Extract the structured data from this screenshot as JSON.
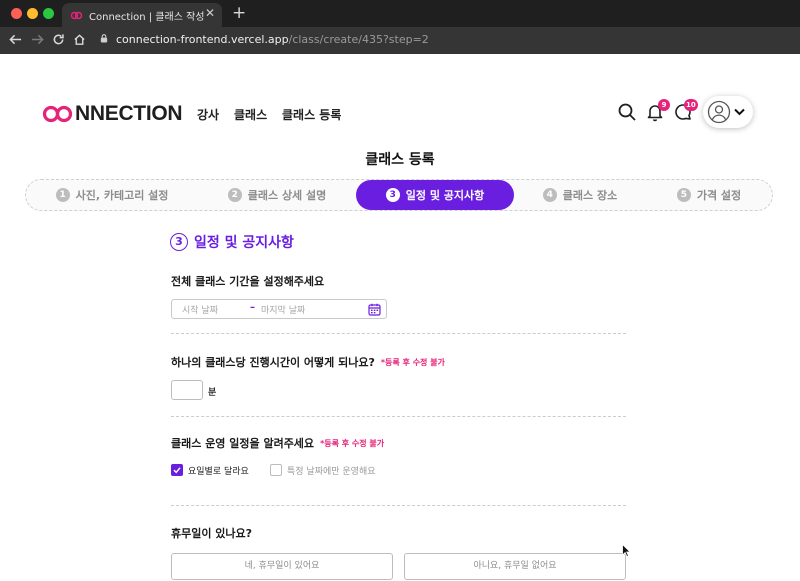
{
  "browser": {
    "tab_title": "Connection | 클래스 작성",
    "tab_close": "✕",
    "new_tab": "+",
    "url_host": "connection-frontend.vercel.app",
    "url_path": "/class/create/435?step=2"
  },
  "header": {
    "logo_text": "NNECTION",
    "nav": [
      "강사",
      "클래스",
      "클래스 등록"
    ],
    "notification_count": "9",
    "message_count": "10"
  },
  "page_title": "클래스 등록",
  "steps": [
    {
      "num": "1",
      "label": "사진, 카테고리 설정"
    },
    {
      "num": "2",
      "label": "클래스 상세 설명"
    },
    {
      "num": "3",
      "label": "일정 및 공지사항"
    },
    {
      "num": "4",
      "label": "클래스 장소"
    },
    {
      "num": "5",
      "label": "가격 설정"
    }
  ],
  "active_step": 3,
  "section": {
    "num": "3",
    "title": "일정 및 공지사항"
  },
  "period": {
    "question": "전체 클래스 기간을 설정해주세요",
    "start_placeholder": "시작 날짜",
    "separator": "–",
    "end_placeholder": "마지막 날짜"
  },
  "duration": {
    "question": "하나의 클래스당 진행시간이 어떻게 되나요?",
    "note": "*등록 후 수정 불가",
    "unit": "분"
  },
  "schedule": {
    "question": "클래스 운영 일정을 알려주세요",
    "note": "*등록 후 수정 불가",
    "options": [
      {
        "label": "요일별로 달라요",
        "checked": true
      },
      {
        "label": "특정 날짜에만 운영해요",
        "checked": false
      }
    ]
  },
  "holiday": {
    "question": "휴무일이 있나요?",
    "yes_label": "네, 휴무일이 있어요",
    "no_label": "아니요, 휴무일 없어요"
  },
  "colors": {
    "accent": "#6a1ee0",
    "pink": "#e6237a"
  }
}
